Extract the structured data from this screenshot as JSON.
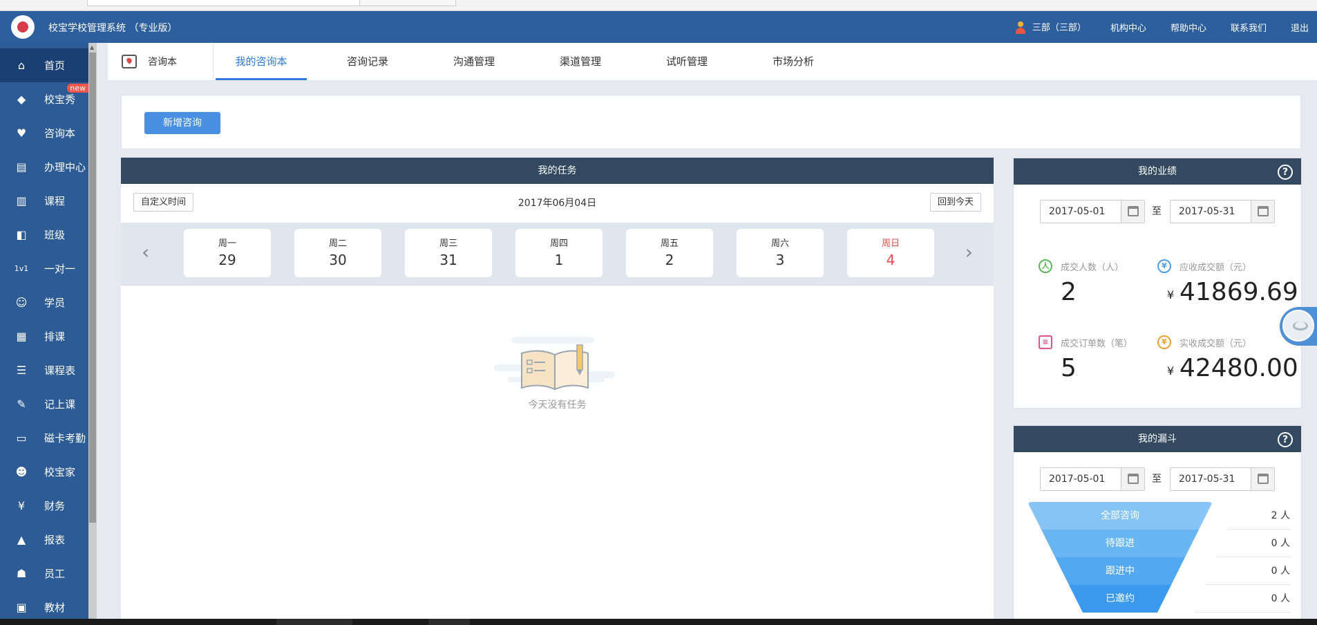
{
  "app": {
    "title": "校宝学校管理系统 （专业版）",
    "user": "三部（三部）",
    "header_links": [
      "机构中心",
      "帮助中心",
      "联系我们",
      "退出"
    ]
  },
  "sidebar": {
    "items": [
      {
        "label": "首页",
        "icon": "home-icon",
        "active": true
      },
      {
        "label": "校宝秀",
        "icon": "xiaobao-show-icon",
        "badge": "new"
      },
      {
        "label": "咨询本",
        "icon": "consult-book-icon"
      },
      {
        "label": "办理中心",
        "icon": "service-center-icon"
      },
      {
        "label": "课程",
        "icon": "course-icon"
      },
      {
        "label": "班级",
        "icon": "class-icon"
      },
      {
        "label": "一对一",
        "icon": "one-on-one-icon"
      },
      {
        "label": "学员",
        "icon": "student-icon"
      },
      {
        "label": "排课",
        "icon": "schedule-icon"
      },
      {
        "label": "课程表",
        "icon": "timetable-icon"
      },
      {
        "label": "记上课",
        "icon": "attendance-record-icon"
      },
      {
        "label": "磁卡考勤",
        "icon": "card-attendance-icon"
      },
      {
        "label": "校宝家",
        "icon": "xiaobao-home-icon"
      },
      {
        "label": "财务",
        "icon": "finance-icon"
      },
      {
        "label": "报表",
        "icon": "report-icon"
      },
      {
        "label": "员工",
        "icon": "staff-icon"
      },
      {
        "label": "教材",
        "icon": "textbook-icon"
      }
    ]
  },
  "topnav": {
    "module": "咨询本",
    "tabs": [
      {
        "label": "我的咨询本",
        "active": true
      },
      {
        "label": "咨询记录"
      },
      {
        "label": "沟通管理"
      },
      {
        "label": "渠道管理"
      },
      {
        "label": "试听管理"
      },
      {
        "label": "市场分析"
      }
    ]
  },
  "actions": {
    "add_consult": "新增咨询"
  },
  "tasks": {
    "title": "我的任务",
    "custom_time": "自定义时间",
    "date": "2017年06月04日",
    "back_today": "回到今天",
    "days": [
      {
        "weekday": "周一",
        "day": "29"
      },
      {
        "weekday": "周二",
        "day": "30"
      },
      {
        "weekday": "周三",
        "day": "31"
      },
      {
        "weekday": "周四",
        "day": "1"
      },
      {
        "weekday": "周五",
        "day": "2"
      },
      {
        "weekday": "周六",
        "day": "3"
      },
      {
        "weekday": "周日",
        "day": "4",
        "today": true
      }
    ],
    "empty_text": "今天没有任务"
  },
  "performance": {
    "title": "我的业绩",
    "from": "2017-05-01",
    "to": "2017-05-31",
    "sep": "至",
    "stats": {
      "deal_people": {
        "label": "成交人数（人）",
        "value": "2"
      },
      "receivable": {
        "label": "应收成交额（元）",
        "value": "41869.69",
        "currency": "¥"
      },
      "deal_orders": {
        "label": "成交订单数（笔）",
        "value": "5"
      },
      "received": {
        "label": "实收成交额（元）",
        "value": "42480.00",
        "currency": "¥"
      }
    }
  },
  "funnel": {
    "title": "我的漏斗",
    "from": "2017-05-01",
    "to": "2017-05-31",
    "sep": "至",
    "stages": [
      {
        "label": "全部咨询",
        "count": "2 人"
      },
      {
        "label": "待跟进",
        "count": "0 人"
      },
      {
        "label": "跟进中",
        "count": "0 人"
      },
      {
        "label": "已邀约",
        "count": "0 人"
      }
    ]
  },
  "colors": {
    "header": "#2d5f9e",
    "accent": "#2d7bd7",
    "panel_head": "#324960",
    "today": "#f04848"
  }
}
